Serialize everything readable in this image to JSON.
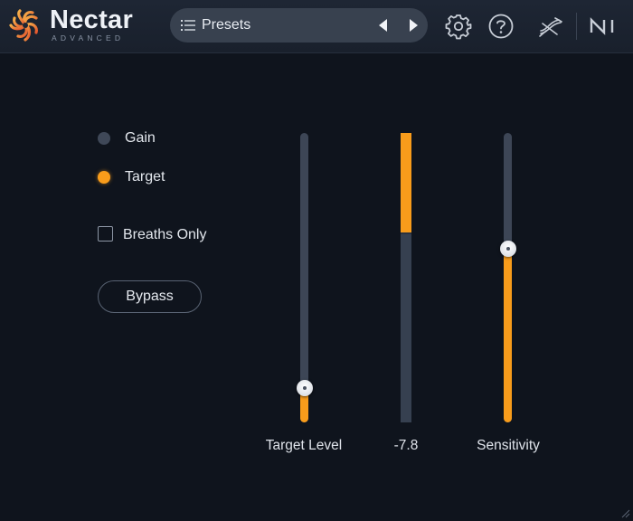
{
  "app": {
    "title": "Nectar",
    "subtitle": "ADVANCED"
  },
  "header": {
    "preset_label": "Presets",
    "icons": [
      "list-icon",
      "chevron-left-icon",
      "chevron-right-icon",
      "gear-icon",
      "help-icon",
      "routing-icon",
      "ni-logo-icon"
    ]
  },
  "mode": {
    "options": [
      {
        "label": "Gain",
        "selected": false
      },
      {
        "label": "Target",
        "selected": true
      }
    ]
  },
  "breaths_only": {
    "label": "Breaths Only",
    "checked": false
  },
  "bypass": {
    "label": "Bypass"
  },
  "target_level": {
    "label": "Target Level",
    "value_fraction": 0.12
  },
  "meter": {
    "label": "-7.8",
    "fill_fraction": 0.35
  },
  "sensitivity": {
    "label": "Sensitivity",
    "value_fraction": 0.6
  },
  "colors": {
    "accent": "#f89c1b",
    "background": "#0f141d",
    "header": "#1e2634",
    "track": "#3d4656"
  }
}
